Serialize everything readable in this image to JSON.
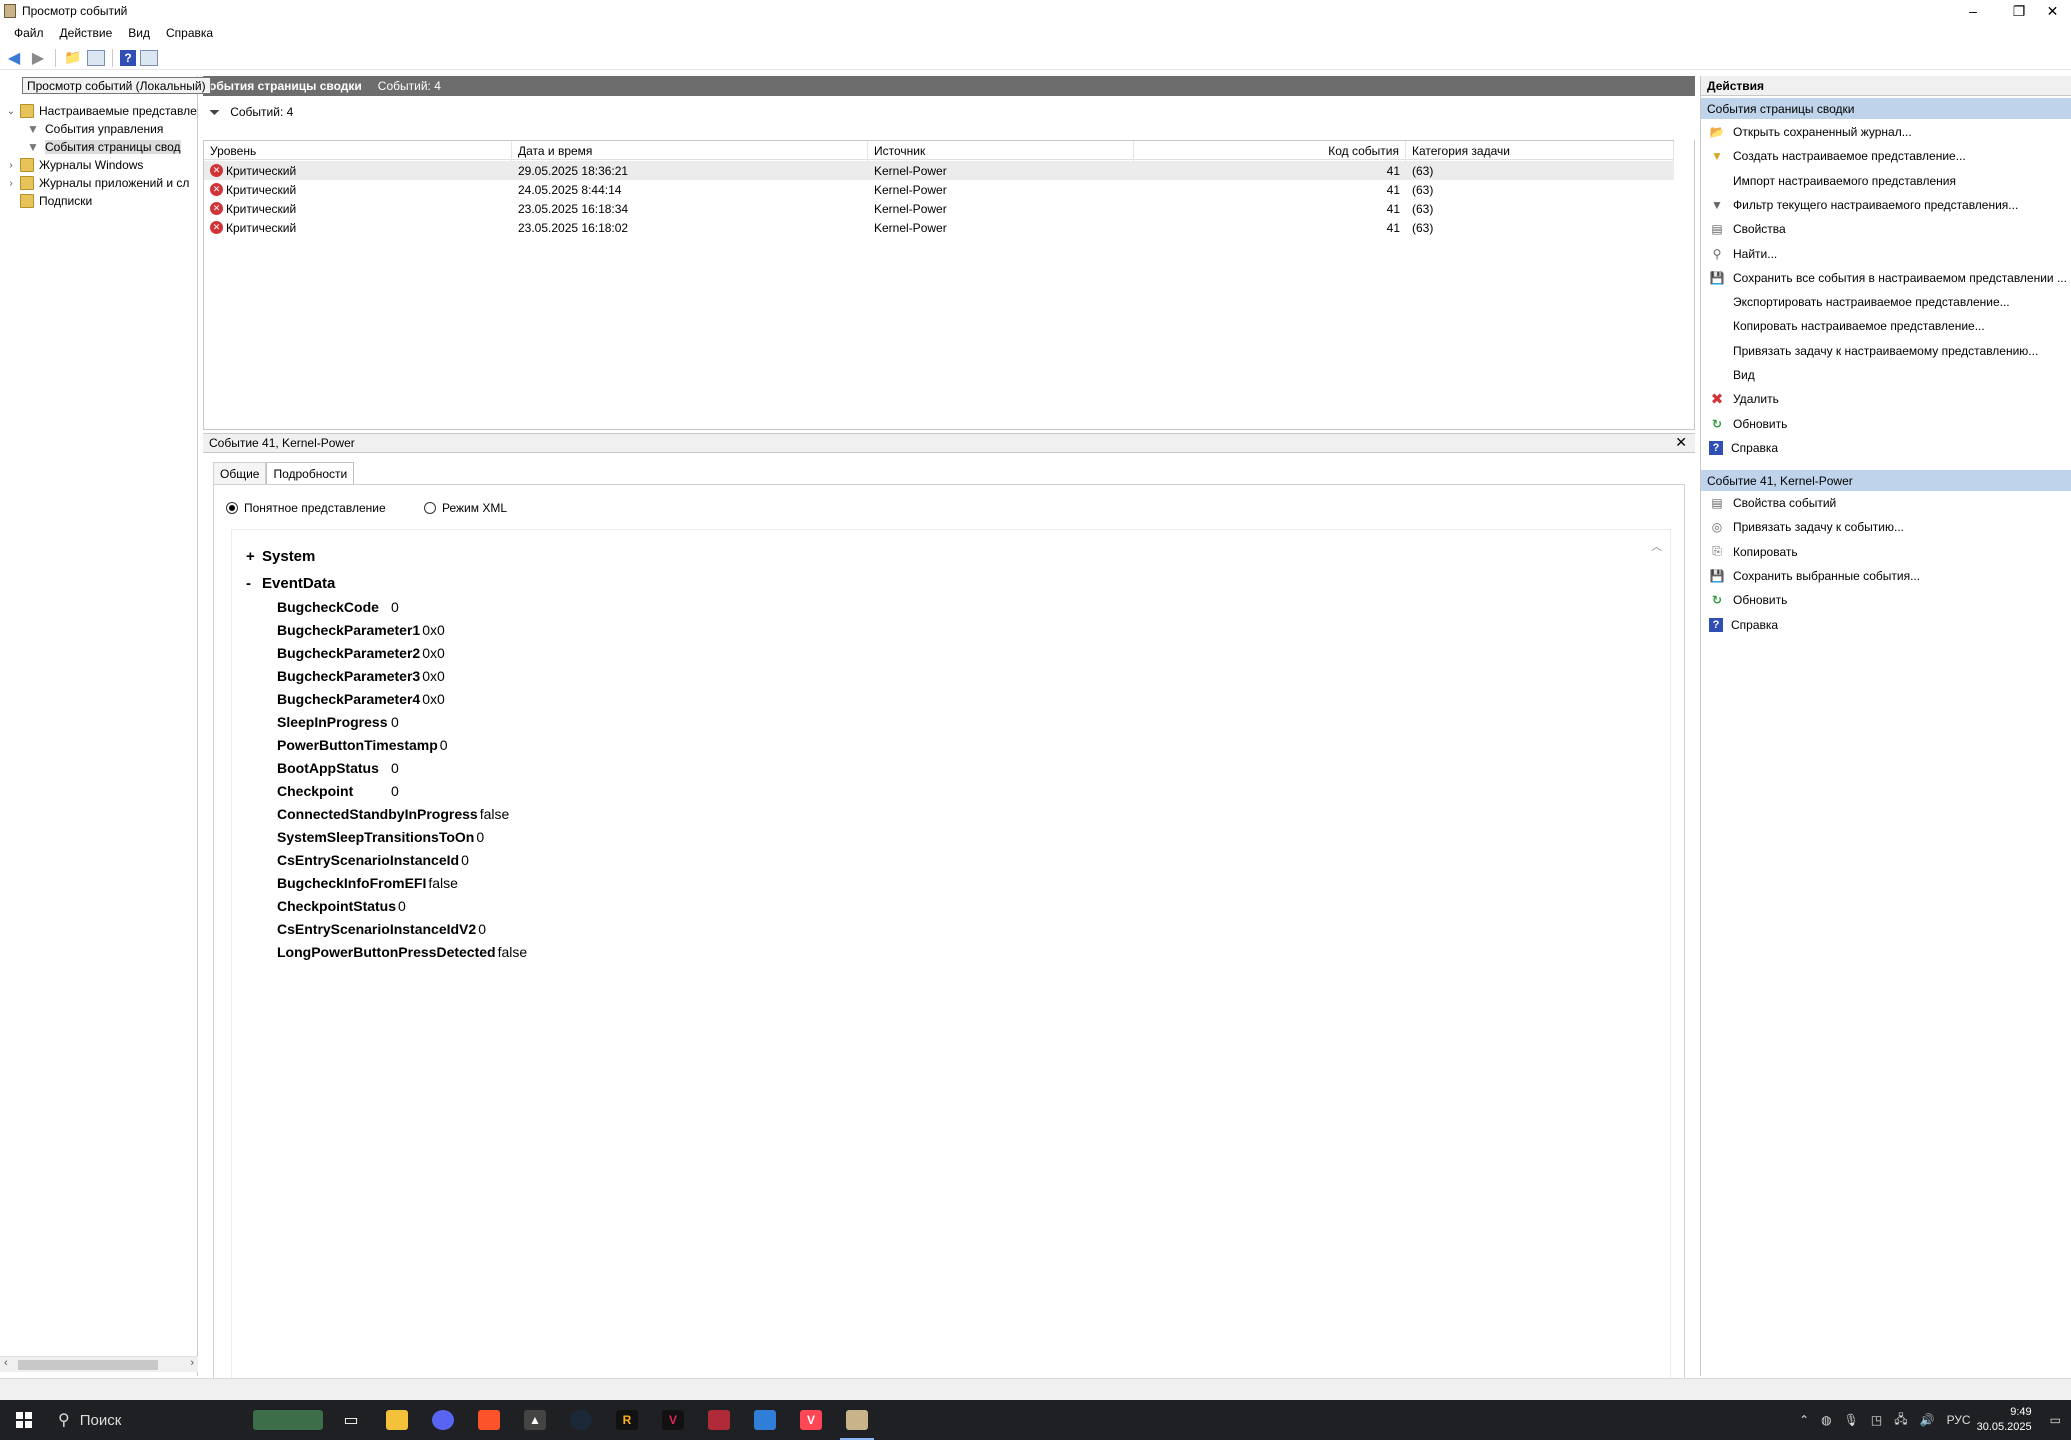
{
  "window": {
    "title": "Просмотр событий",
    "controls": [
      "–",
      "❐",
      "✕"
    ]
  },
  "menu": [
    "Файл",
    "Действие",
    "Вид",
    "Справка"
  ],
  "tree": {
    "tooltip": "Просмотр событий (Локальный)",
    "items": [
      {
        "label": "Настраиваемые представле",
        "icon": "folder-icon",
        "expander": "⌄"
      },
      {
        "label": "События управления",
        "icon": "filter-icon",
        "expander": ""
      },
      {
        "label": "События страницы свод",
        "icon": "filter-icon",
        "expander": ""
      },
      {
        "label": "Журналы Windows",
        "icon": "folder-icon",
        "expander": "›"
      },
      {
        "label": "Журналы приложений и сл",
        "icon": "folder-icon",
        "expander": "›"
      },
      {
        "label": "Подписки",
        "icon": "folder-icon",
        "expander": ""
      }
    ]
  },
  "center": {
    "header_title": "обытия страницы сводки",
    "header_count": "Событий: 4",
    "filter_text": "Событий: 4",
    "columns": [
      "Уровень",
      "Дата и время",
      "Источник",
      "Код события",
      "Категория задачи"
    ],
    "rows": [
      {
        "level": "Критический",
        "datetime": "29.05.2025 18:36:21",
        "source": "Kernel-Power",
        "id": "41",
        "category": "(63)"
      },
      {
        "level": "Критический",
        "datetime": "24.05.2025 8:44:14",
        "source": "Kernel-Power",
        "id": "41",
        "category": "(63)"
      },
      {
        "level": "Критический",
        "datetime": "23.05.2025 16:18:34",
        "source": "Kernel-Power",
        "id": "41",
        "category": "(63)"
      },
      {
        "level": "Критический",
        "datetime": "23.05.2025 16:18:02",
        "source": "Kernel-Power",
        "id": "41",
        "category": "(63)"
      }
    ],
    "detail": {
      "title": "Событие 41, Kernel-Power",
      "tabs": [
        "Общие",
        "Подробности"
      ],
      "radio_friendly": "Понятное представление",
      "radio_xml": "Режим XML",
      "system_label": "System",
      "eventdata_label": "EventData",
      "system_sign": "+",
      "eventdata_sign": "-",
      "fields": [
        {
          "k": "BugcheckCode",
          "v": "0"
        },
        {
          "k": "BugcheckParameter1",
          "v": "0x0"
        },
        {
          "k": "BugcheckParameter2",
          "v": "0x0"
        },
        {
          "k": "BugcheckParameter3",
          "v": "0x0"
        },
        {
          "k": "BugcheckParameter4",
          "v": "0x0"
        },
        {
          "k": "SleepInProgress",
          "v": "0"
        },
        {
          "k": "PowerButtonTimestamp",
          "v": "0"
        },
        {
          "k": "BootAppStatus",
          "v": "0"
        },
        {
          "k": "Checkpoint",
          "v": "0"
        },
        {
          "k": "ConnectedStandbyInProgress",
          "v": "false"
        },
        {
          "k": "SystemSleepTransitionsToOn",
          "v": "0"
        },
        {
          "k": "CsEntryScenarioInstanceId",
          "v": "0"
        },
        {
          "k": "BugcheckInfoFromEFI",
          "v": "false"
        },
        {
          "k": "CheckpointStatus",
          "v": "0"
        },
        {
          "k": "CsEntryScenarioInstanceIdV2",
          "v": "0"
        },
        {
          "k": "LongPowerButtonPressDetected",
          "v": "false"
        }
      ]
    }
  },
  "actions": {
    "title": "Действия",
    "section1": "События страницы сводки",
    "section1_items": [
      {
        "label": "Открыть сохраненный журнал...",
        "icon": "open-log-icon",
        "glyph": "📂",
        "cls": "folder"
      },
      {
        "label": "Создать настраиваемое представление...",
        "icon": "filter-icon",
        "glyph": "▼",
        "cls": "folder"
      },
      {
        "label": "Импорт настраиваемого представления",
        "icon": "",
        "glyph": "",
        "cls": ""
      },
      {
        "label": "Фильтр текущего настраиваемого представления...",
        "icon": "filter-icon",
        "glyph": "▼",
        "cls": "grey"
      },
      {
        "label": "Свойства",
        "icon": "properties-icon",
        "glyph": "▤",
        "cls": "grey"
      },
      {
        "label": "Найти...",
        "icon": "binoculars-icon",
        "glyph": "⚲",
        "cls": "grey"
      },
      {
        "label": "Сохранить все события в настраиваемом представлении ...",
        "icon": "save-icon",
        "glyph": "💾",
        "cls": "grey"
      },
      {
        "label": "Экспортировать настраиваемое представление...",
        "icon": "",
        "glyph": "",
        "cls": ""
      },
      {
        "label": "Копировать настраиваемое представление...",
        "icon": "",
        "glyph": "",
        "cls": ""
      },
      {
        "label": "Привязать задачу к настраиваемому представлению...",
        "icon": "",
        "glyph": "",
        "cls": ""
      },
      {
        "label": "Вид",
        "icon": "",
        "glyph": "",
        "cls": ""
      },
      {
        "label": "Удалить",
        "icon": "delete-icon",
        "glyph": "✖",
        "cls": "red"
      },
      {
        "label": "Обновить",
        "icon": "refresh-icon",
        "glyph": "↻",
        "cls": "green"
      },
      {
        "label": "Справка",
        "icon": "help-icon",
        "glyph": "?",
        "cls": "help"
      }
    ],
    "section2": "Событие 41, Kernel-Power",
    "section2_items": [
      {
        "label": "Свойства событий",
        "icon": "properties-icon",
        "glyph": "▤",
        "cls": "grey"
      },
      {
        "label": "Привязать задачу к событию...",
        "icon": "task-icon",
        "glyph": "◎",
        "cls": "grey"
      },
      {
        "label": "Копировать",
        "icon": "copy-icon",
        "glyph": "⎘",
        "cls": "grey"
      },
      {
        "label": "Сохранить выбранные события...",
        "icon": "save-icon",
        "glyph": "💾",
        "cls": "grey"
      },
      {
        "label": "Обновить",
        "icon": "refresh-icon",
        "glyph": "↻",
        "cls": "green"
      },
      {
        "label": "Справка",
        "icon": "help-icon",
        "glyph": "?",
        "cls": "help"
      }
    ]
  },
  "taskbar": {
    "search_label": "Поиск",
    "lang": "РУС",
    "time": "9:49",
    "date": "30.05.2025"
  }
}
